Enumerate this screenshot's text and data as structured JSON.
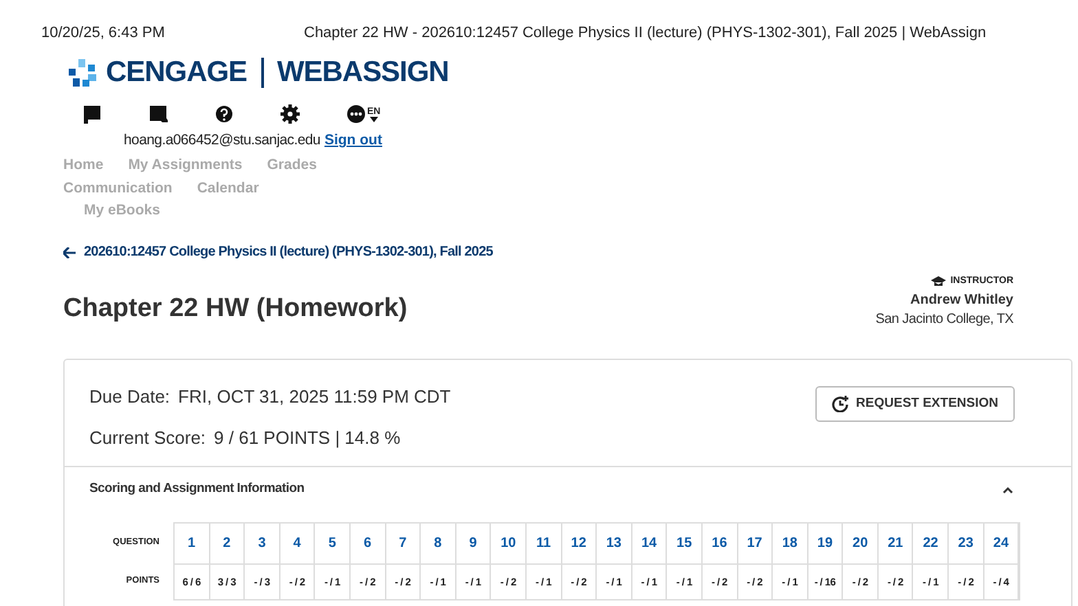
{
  "print_header": {
    "date": "10/20/25, 6:43 PM",
    "title": "Chapter 22 HW - 202610:12457 College Physics II (lecture) (PHYS-1302-301), Fall 2025 | WebAssign"
  },
  "logo": {
    "brand": "CENGAGE",
    "product": "WEBASSIGN"
  },
  "toolbar": {
    "language": "EN"
  },
  "user": {
    "email": "hoang.a066452@stu.sanjac.edu",
    "sign_out": "Sign out"
  },
  "nav": [
    [
      "Home",
      "My Assignments",
      "Grades"
    ],
    [
      "Communication",
      "Calendar"
    ],
    [
      "My eBooks"
    ]
  ],
  "back_link": "202610:12457 College Physics II (lecture) (PHYS-1302-301), Fall 2025",
  "page_title": "Chapter 22 HW (Homework)",
  "instructor": {
    "label": "INSTRUCTOR",
    "name": "Andrew Whitley",
    "school": "San Jacinto College, TX"
  },
  "due": {
    "label": "Due Date:",
    "value": "FRI, OCT 31, 2025 11:59 PM CDT"
  },
  "score": {
    "label": "Current Score:",
    "value": "9 / 61 POINTS | 14.8 %"
  },
  "request_button": "REQUEST EXTENSION",
  "section": {
    "title": "Scoring and Assignment Information",
    "expanded": true
  },
  "table": {
    "row_labels": [
      "QUESTION",
      "POINTS"
    ],
    "questions": [
      {
        "number": "1",
        "points": "6 / 6"
      },
      {
        "number": "2",
        "points": "3 / 3"
      },
      {
        "number": "3",
        "points": "- / 3"
      },
      {
        "number": "4",
        "points": "- / 2"
      },
      {
        "number": "5",
        "points": "- / 1"
      },
      {
        "number": "6",
        "points": "- / 2"
      },
      {
        "number": "7",
        "points": "- / 2"
      },
      {
        "number": "8",
        "points": "- / 1"
      },
      {
        "number": "9",
        "points": "- / 1"
      },
      {
        "number": "10",
        "points": "- / 2"
      },
      {
        "number": "11",
        "points": "- / 1"
      },
      {
        "number": "12",
        "points": "- / 2"
      },
      {
        "number": "13",
        "points": "- / 1"
      },
      {
        "number": "14",
        "points": "- / 1"
      },
      {
        "number": "15",
        "points": "- / 1"
      },
      {
        "number": "16",
        "points": "- / 2"
      },
      {
        "number": "17",
        "points": "- / 2"
      },
      {
        "number": "18",
        "points": "- / 1"
      },
      {
        "number": "19",
        "points": "- / 16"
      },
      {
        "number": "20",
        "points": "- / 2"
      },
      {
        "number": "21",
        "points": "- / 2"
      },
      {
        "number": "22",
        "points": "- / 1"
      },
      {
        "number": "23",
        "points": "- / 2"
      },
      {
        "number": "24",
        "points": "- / 4"
      }
    ]
  }
}
